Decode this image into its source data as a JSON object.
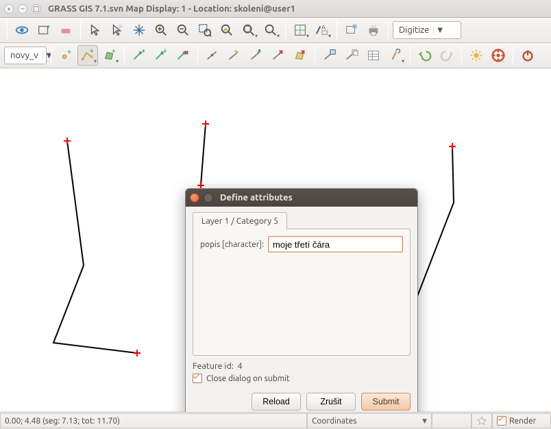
{
  "window": {
    "title": "GRASS GIS 7.1.svn Map Display: 1  - Location: skoleni@user1"
  },
  "toolbar1": {
    "mode_combo": "Digitize"
  },
  "toolbar2": {
    "layer_combo": "novy_v"
  },
  "dialog": {
    "title": "Define attributes",
    "tab_label": "Layer 1 / Category 5",
    "field_label": "popis [character]:",
    "field_value": "moje třetí čára",
    "feature_label": "Feature id:",
    "feature_value": "4",
    "close_checkbox": "Close dialog on submit",
    "reload": "Reload",
    "cancel": "Zrušit",
    "submit": "Submit"
  },
  "statusbar": {
    "info": "0.00; 4.48 (seg: 7.13; tot: 11.70)",
    "mode": "Coordinates",
    "render": "Render"
  },
  "icons": {}
}
